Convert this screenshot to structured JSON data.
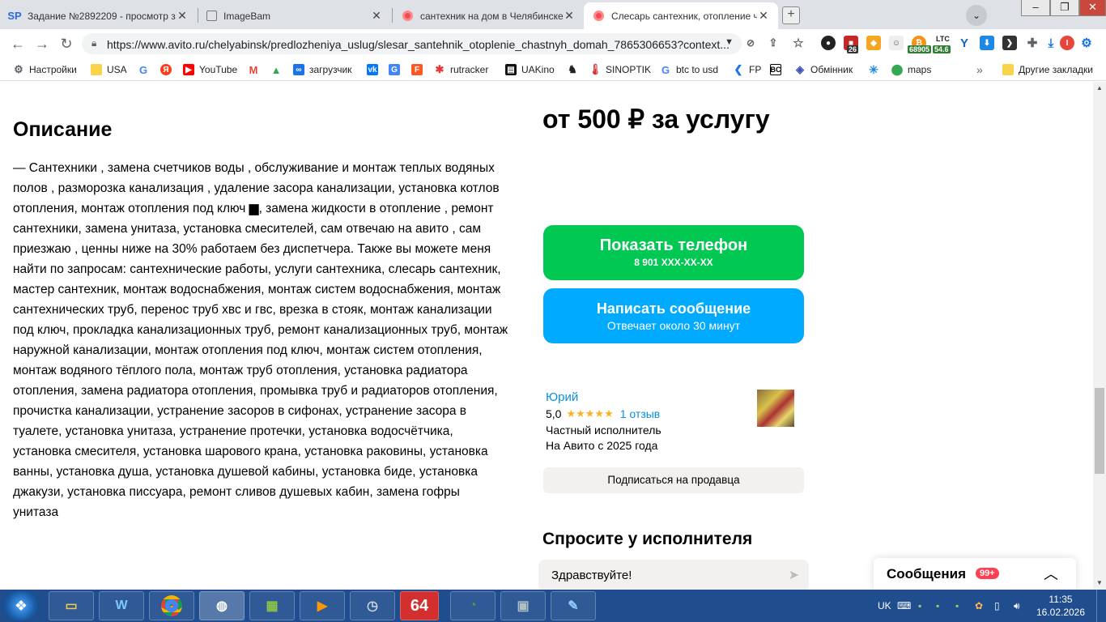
{
  "browser": {
    "tabs": [
      {
        "favicon": "SP",
        "title": "Задание №2892209 - просмотр з"
      },
      {
        "favicon": "imagebam-icon",
        "title": "ImageBam"
      },
      {
        "favicon": "avito-icon",
        "title": "сантехник на дом в Челябинске -"
      },
      {
        "favicon": "avito-icon",
        "title": "Слесарь сантехник, отопление ча"
      }
    ],
    "url": "https://www.avito.ru/chelyabinsk/predlozheniya_uslug/slesar_santehnik_otoplenie_chastnyh_domah_7865306653?context...",
    "extension_badges": {
      "ext1": "26",
      "btc": "68905",
      "ltc_label": "LTC",
      "ltc_value": "54.6"
    },
    "bookmarks": [
      "Настройки",
      "USA",
      "",
      "",
      "YouTube",
      "",
      "",
      "загрузчик",
      "",
      "",
      "",
      "rutracker",
      "UAKino",
      "",
      "SINOPTIK",
      "btc to usd",
      "FP",
      "",
      "Обмінник",
      "",
      "maps"
    ],
    "other_bookmarks": "Другие закладки"
  },
  "page": {
    "description_title": "Описание",
    "description_text": "— Сантехники , замена счетчиков воды , обслуживание и монтаж теплых водяных полов , разморозка канализация , удаление засора канализации, установка котлов отопления, монтаж отопления под ключ ▆, замена жидкости в отопление , ремонт сантехники, замена унитаза, установка смесителей, сам отвечаю на авито , сам приезжаю , ценны ниже на 30% работаем без диспетчера. Также вы можете меня найти по запросам: сантехнические работы, услуги сантехника, слесарь сантехник, мастер сантехник, монтаж водоснабжения, монтаж систем водоснабжения, монтаж сантехнических труб, перенос труб хвс и гвс, врезка в стояк, монтаж канализации под ключ, прокладка канализационных труб, ремонт канализационных труб, монтаж наружной канализации, монтаж отопления под ключ, монтаж систем отопления, монтаж водяного тёплого пола, монтаж труб отопления, установка радиатора отопления, замена радиатора отопления, промывка труб и радиаторов отопления, прочистка канализации, устранение засоров в сифонах, устранение засора в туалете, установка унитаза, устранение протечки, установка водосчётчика, установка смесителя, установка шарового крана, установка раковины, установка ванны, установка душа, установка душевой кабины, установка биде, установка джакузи, установка писсуара, ремонт сливов душевых кабин, замена гофры унитаза",
    "price": "от 500 ₽ за услугу",
    "show_phone": {
      "label": "Показать телефон",
      "phone": "8 901 XXX-XX-XX"
    },
    "write_message": {
      "label": "Написать сообщение",
      "sub": "Отвечает около 30 минут"
    },
    "seller": {
      "name": "Юрий",
      "rating": "5,0",
      "stars": "★★★★★",
      "reviews": "1 отзыв",
      "type": "Частный исполнитель",
      "since": "На Авито с 2025 года"
    },
    "subscribe": "Подписаться на продавца",
    "ask_title": "Спросите у исполнителя",
    "ask_input_value": "Здравствуйте!",
    "messages_widget": {
      "title": "Сообщения",
      "badge": "99+"
    }
  },
  "taskbar": {
    "app_badge_64": "64",
    "lang": "UK",
    "time": "11:35",
    "date": "16.02.2026"
  },
  "colors": {
    "accent_green": "#00c853",
    "accent_blue": "#00aaff",
    "link_blue": "#0a8fe0",
    "star": "#ffb021",
    "badge_red": "#ff4053",
    "taskbar": "#1f4d8e"
  }
}
